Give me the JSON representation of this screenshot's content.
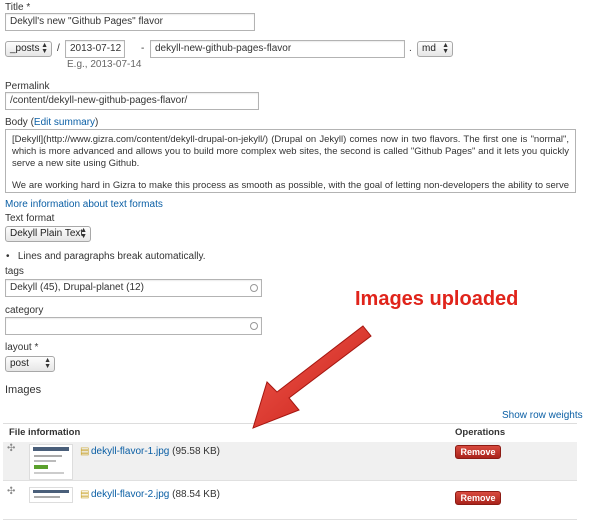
{
  "title_field": {
    "label": "Title",
    "required_mark": "*",
    "value": "Dekyll's new \"Github Pages\" flavor"
  },
  "path": {
    "folder_select": "_posts",
    "sep1": "/",
    "date_value": "2013-07-12",
    "date_hint": "E.g., 2013-07-14",
    "sep2": "-",
    "slug_value": "dekyll-new-github-pages-flavor",
    "sep3": ".",
    "ext_select": "md"
  },
  "permalink": {
    "label": "Permalink",
    "value": "/content/dekyll-new-github-pages-flavor/"
  },
  "body": {
    "label": "Body",
    "edit_summary_open": "(",
    "edit_summary_link": "Edit summary",
    "edit_summary_close": ")",
    "paragraph1": "[Dekyll](http://www.gizra.com/content/dekyll-drupal-on-jekyll/) (Drupal on Jekyll) comes now in two flavors. The first one is \"normal\", which is more advanced and allows you to build more complex web sites, the second is called \"Github Pages\" and it lets you quickly serve a new site using Github.",
    "paragraph2": "We are working hard in Gizra to make this process as smooth as possible, with the goal of letting non-developers the ability to serve their content using Jekyll on Github Pages - without them having to bother with knowing what Jekyll, Git or Github Pages are. A worthy goal"
  },
  "text_formats": {
    "more_info_link": "More information about text formats",
    "label": "Text format",
    "selected": "Dekyll Plain Text",
    "tip": "Lines and paragraphs break automatically."
  },
  "tags": {
    "label": "tags",
    "value": "Dekyll (45), Drupal-planet (12)"
  },
  "category": {
    "label": "category",
    "value": ""
  },
  "layout": {
    "label": "layout",
    "required_mark": "*",
    "selected": "post"
  },
  "images": {
    "heading": "Images",
    "show_row_weights": "Show row weights",
    "col_file_info": "File information",
    "col_operations": "Operations",
    "rows": [
      {
        "filename": "dekyll-flavor-1.jpg",
        "size": "(95.58 KB)",
        "remove": "Remove"
      },
      {
        "filename": "dekyll-flavor-2.jpg",
        "size": "(88.54 KB)",
        "remove": "Remove"
      }
    ]
  },
  "annotation": {
    "text": "Images uploaded",
    "color": "#e0241b"
  },
  "colors": {
    "link": "#0b5fa5",
    "remove_button": "#c0392b",
    "arrow": "#e0241b"
  }
}
